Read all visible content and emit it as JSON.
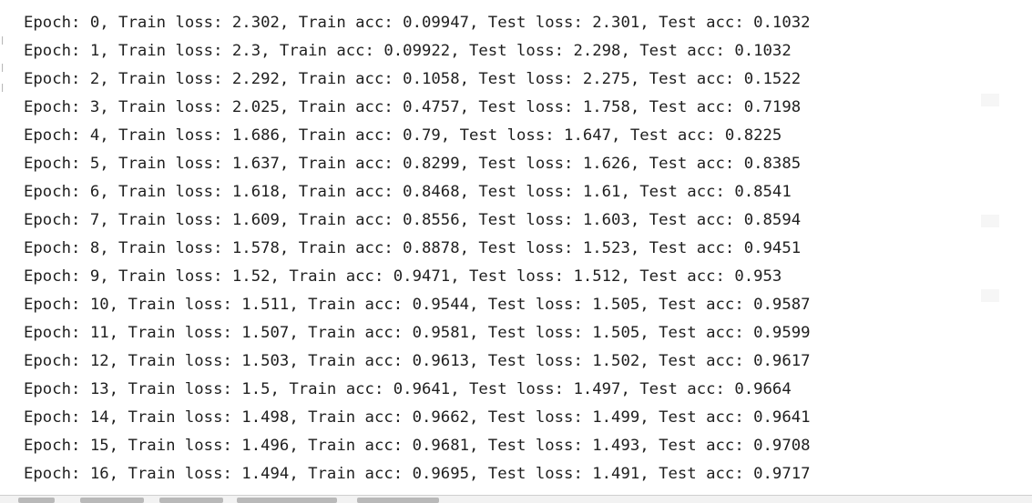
{
  "console": {
    "cut_top_text": "Epoch 0 cut off",
    "lines": [
      "Epoch: 0, Train loss: 2.302, Train acc: 0.09947, Test loss: 2.301, Test acc: 0.1032",
      "Epoch: 1, Train loss: 2.3, Train acc: 0.09922, Test loss: 2.298, Test acc: 0.1032",
      "Epoch: 2, Train loss: 2.292, Train acc: 0.1058, Test loss: 2.275, Test acc: 0.1522",
      "Epoch: 3, Train loss: 2.025, Train acc: 0.4757, Test loss: 1.758, Test acc: 0.7198",
      "Epoch: 4, Train loss: 1.686, Train acc: 0.79, Test loss: 1.647, Test acc: 0.8225",
      "Epoch: 5, Train loss: 1.637, Train acc: 0.8299, Test loss: 1.626, Test acc: 0.8385",
      "Epoch: 6, Train loss: 1.618, Train acc: 0.8468, Test loss: 1.61, Test acc: 0.8541",
      "Epoch: 7, Train loss: 1.609, Train acc: 0.8556, Test loss: 1.603, Test acc: 0.8594",
      "Epoch: 8, Train loss: 1.578, Train acc: 0.8878, Test loss: 1.523, Test acc: 0.9451",
      "Epoch: 9, Train loss: 1.52, Train acc: 0.9471, Test loss: 1.512, Test acc: 0.953",
      "Epoch: 10, Train loss: 1.511, Train acc: 0.9544, Test loss: 1.505, Test acc: 0.9587",
      "Epoch: 11, Train loss: 1.507, Train acc: 0.9581, Test loss: 1.505, Test acc: 0.9599",
      "Epoch: 12, Train loss: 1.503, Train acc: 0.9613, Test loss: 1.502, Test acc: 0.9617",
      "Epoch: 13, Train loss: 1.5, Train acc: 0.9641, Test loss: 1.497, Test acc: 0.9664",
      "Epoch: 14, Train loss: 1.498, Train acc: 0.9662, Test loss: 1.499, Test acc: 0.9641",
      "Epoch: 15, Train loss: 1.496, Train acc: 0.9681, Test loss: 1.493, Test acc: 0.9708",
      "Epoch: 16, Train loss: 1.494, Train acc: 0.9695, Test loss: 1.491, Test acc: 0.9717"
    ]
  },
  "colors": {
    "text": "#1f1f1f",
    "cut_text": "#c0392b",
    "background": "#ffffff",
    "statusbar": "#f2f2f2"
  }
}
